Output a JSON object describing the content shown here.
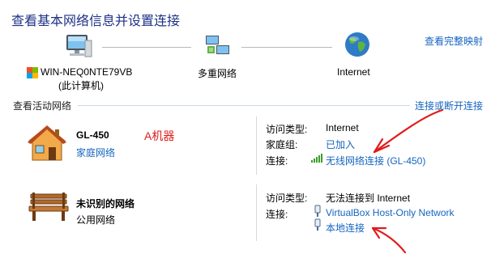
{
  "header": {
    "title": "查看基本网络信息并设置连接",
    "full_map_link": "查看完整映射"
  },
  "network_map": {
    "computer_name": "WIN-NEQ0NTE79VB",
    "computer_sub": "(此计算机)",
    "middle_label": "多重网络",
    "internet_label": "Internet"
  },
  "active_networks": {
    "section_label": "查看活动网络",
    "connect_link": "连接或断开连接",
    "networks": [
      {
        "name": "GL-450",
        "type_link": "家庭网络",
        "annotation": "A机器",
        "access_type_key": "访问类型:",
        "access_type_value": "Internet",
        "homegroup_key": "家庭组:",
        "homegroup_value": "已加入",
        "connection_key": "连接:",
        "connection_value": "无线网络连接 (GL-450)"
      },
      {
        "name": "未识别的网络",
        "type": "公用网络",
        "access_type_key": "访问类型:",
        "access_type_value": "无法连接到 Internet",
        "connection_key": "连接:",
        "connections": [
          "VirtualBox Host-Only Network",
          "本地连接"
        ]
      }
    ]
  },
  "colors": {
    "title": "#1e3287",
    "link": "#1565c0",
    "annotation_red": "#e01b1b"
  }
}
